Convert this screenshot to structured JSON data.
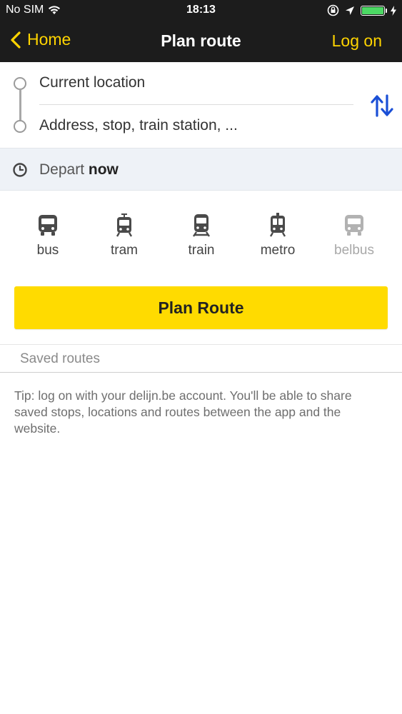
{
  "status_bar": {
    "carrier": "No SIM",
    "time": "18:13",
    "battery_level": 1.0
  },
  "nav": {
    "back_label": "Home",
    "title": "Plan route",
    "login_label": "Log on"
  },
  "route": {
    "from_value": "Current location",
    "to_placeholder": "Address, stop, train station, ..."
  },
  "depart": {
    "prefix": "Depart",
    "value": "now"
  },
  "modes": [
    {
      "label": "bus",
      "icon": "bus-icon",
      "enabled": true
    },
    {
      "label": "tram",
      "icon": "tram-icon",
      "enabled": true
    },
    {
      "label": "train",
      "icon": "train-icon",
      "enabled": true
    },
    {
      "label": "metro",
      "icon": "metro-icon",
      "enabled": true
    },
    {
      "label": "belbus",
      "icon": "belbus-icon",
      "enabled": false
    }
  ],
  "plan_button_label": "Plan Route",
  "saved": {
    "title": "Saved routes",
    "tip": "Tip: log on with your delijn.be account. You'll be able to share saved stops, locations and routes between the app and the website."
  },
  "colors": {
    "accent": "#ffdb00",
    "nav_background": "#1c1c1c",
    "swap_icon": "#1a4fd6",
    "battery": "#4cd964"
  }
}
